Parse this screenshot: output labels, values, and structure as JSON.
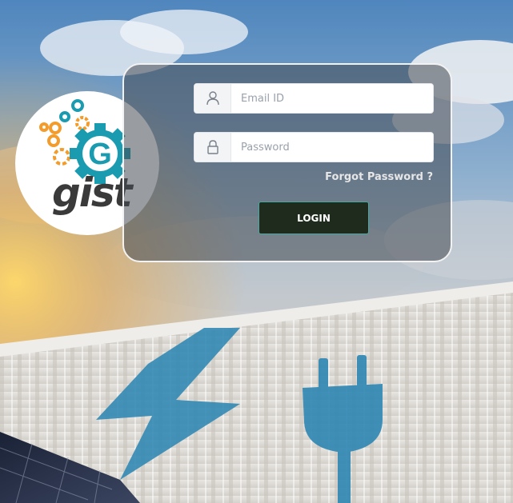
{
  "login": {
    "email": {
      "placeholder": "Email ID",
      "value": "",
      "icon": "user-icon"
    },
    "password": {
      "placeholder": "Password",
      "value": "",
      "icon": "lock-icon"
    },
    "forgot_label": "Forgot Password ?",
    "login_label": "LOGIN"
  },
  "logo": {
    "letter": "G",
    "word": "gist"
  },
  "colors": {
    "accent": "#49a7a0",
    "button": "#1f2c1d",
    "logo_teal": "#1a9bb0",
    "logo_orange": "#f39c2b",
    "logo_text": "#3a3a3a"
  }
}
